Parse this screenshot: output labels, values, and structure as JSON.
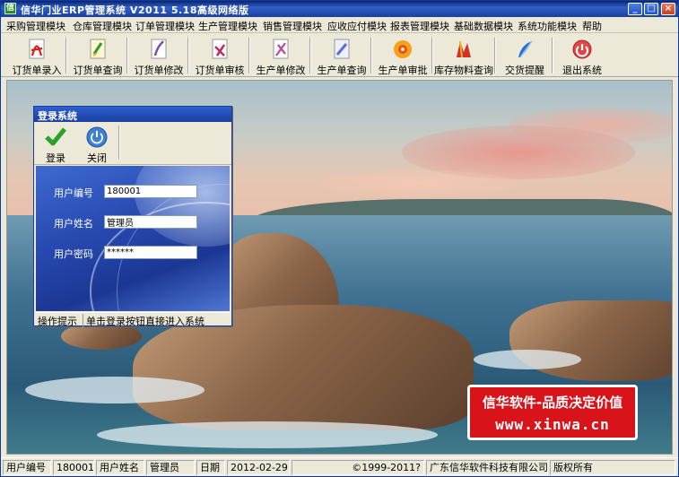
{
  "window": {
    "title": "信华门业ERP管理系统  V2011  5.18高级网络版",
    "minimize": "_",
    "maximize": "□",
    "close": "×"
  },
  "menu": [
    "采购管理模块",
    "仓库管理模块",
    "订单管理模块",
    "生产管理模块",
    "销售管理模块",
    "应收应付模块",
    "报表管理模块",
    "基础数据模块",
    "系统功能模块",
    "帮助"
  ],
  "toolbar": [
    {
      "label": "订货单录入",
      "icon": "pdf-document-icon",
      "color": "#d8201a"
    },
    {
      "label": "订货单查询",
      "icon": "document-search-icon",
      "color": "#2f9a2f"
    },
    {
      "label": "订货单修改",
      "icon": "document-edit-icon",
      "color": "#7a4fb0"
    },
    {
      "label": "订货单审核",
      "icon": "document-approve-icon",
      "color": "#c02c5c"
    },
    {
      "label": "生产单修改",
      "icon": "production-edit-icon",
      "color": "#b64da0"
    },
    {
      "label": "生产单查询",
      "icon": "production-search-icon",
      "color": "#5a6dd0"
    },
    {
      "label": "生产单审批",
      "icon": "production-approve-icon",
      "color": "#e8861a"
    },
    {
      "label": "库存物料查询",
      "icon": "inventory-icon",
      "color": "#d0322a"
    },
    {
      "label": "交货提醒",
      "icon": "delivery-reminder-icon",
      "color": "#2a6ed0"
    },
    {
      "label": "退出系统",
      "icon": "exit-icon",
      "color": "#d83a3a"
    }
  ],
  "login": {
    "title": "登录系统",
    "login_button": "登录",
    "close_button": "关闭",
    "user_id_label": "用户编号",
    "user_id_value": "180001",
    "user_name_label": "用户姓名",
    "user_name_value": "管理员",
    "password_label": "用户密码",
    "password_value": "******",
    "status_label": "操作提示",
    "status_text": "单击登录按钮直接进入系统"
  },
  "promo": {
    "line1": "信华软件-品质决定价值",
    "line2": "www.xinwa.cn"
  },
  "statusbar": {
    "user_id_label": "用户编号",
    "user_id": "180001",
    "user_name_label": "用户姓名",
    "user_name": "管理员",
    "date_label": "日期",
    "date": "2012-02-29",
    "copyright": "©1999-2011?",
    "company": "广东信华软件科技有限公司",
    "rights": "版权所有"
  },
  "colors": {
    "titlebar": "#1c3f9e",
    "chrome": "#ece9d8",
    "login_panel": "#2749b0",
    "promo_bg": "#d8141a",
    "check_green": "#2aa12a"
  }
}
